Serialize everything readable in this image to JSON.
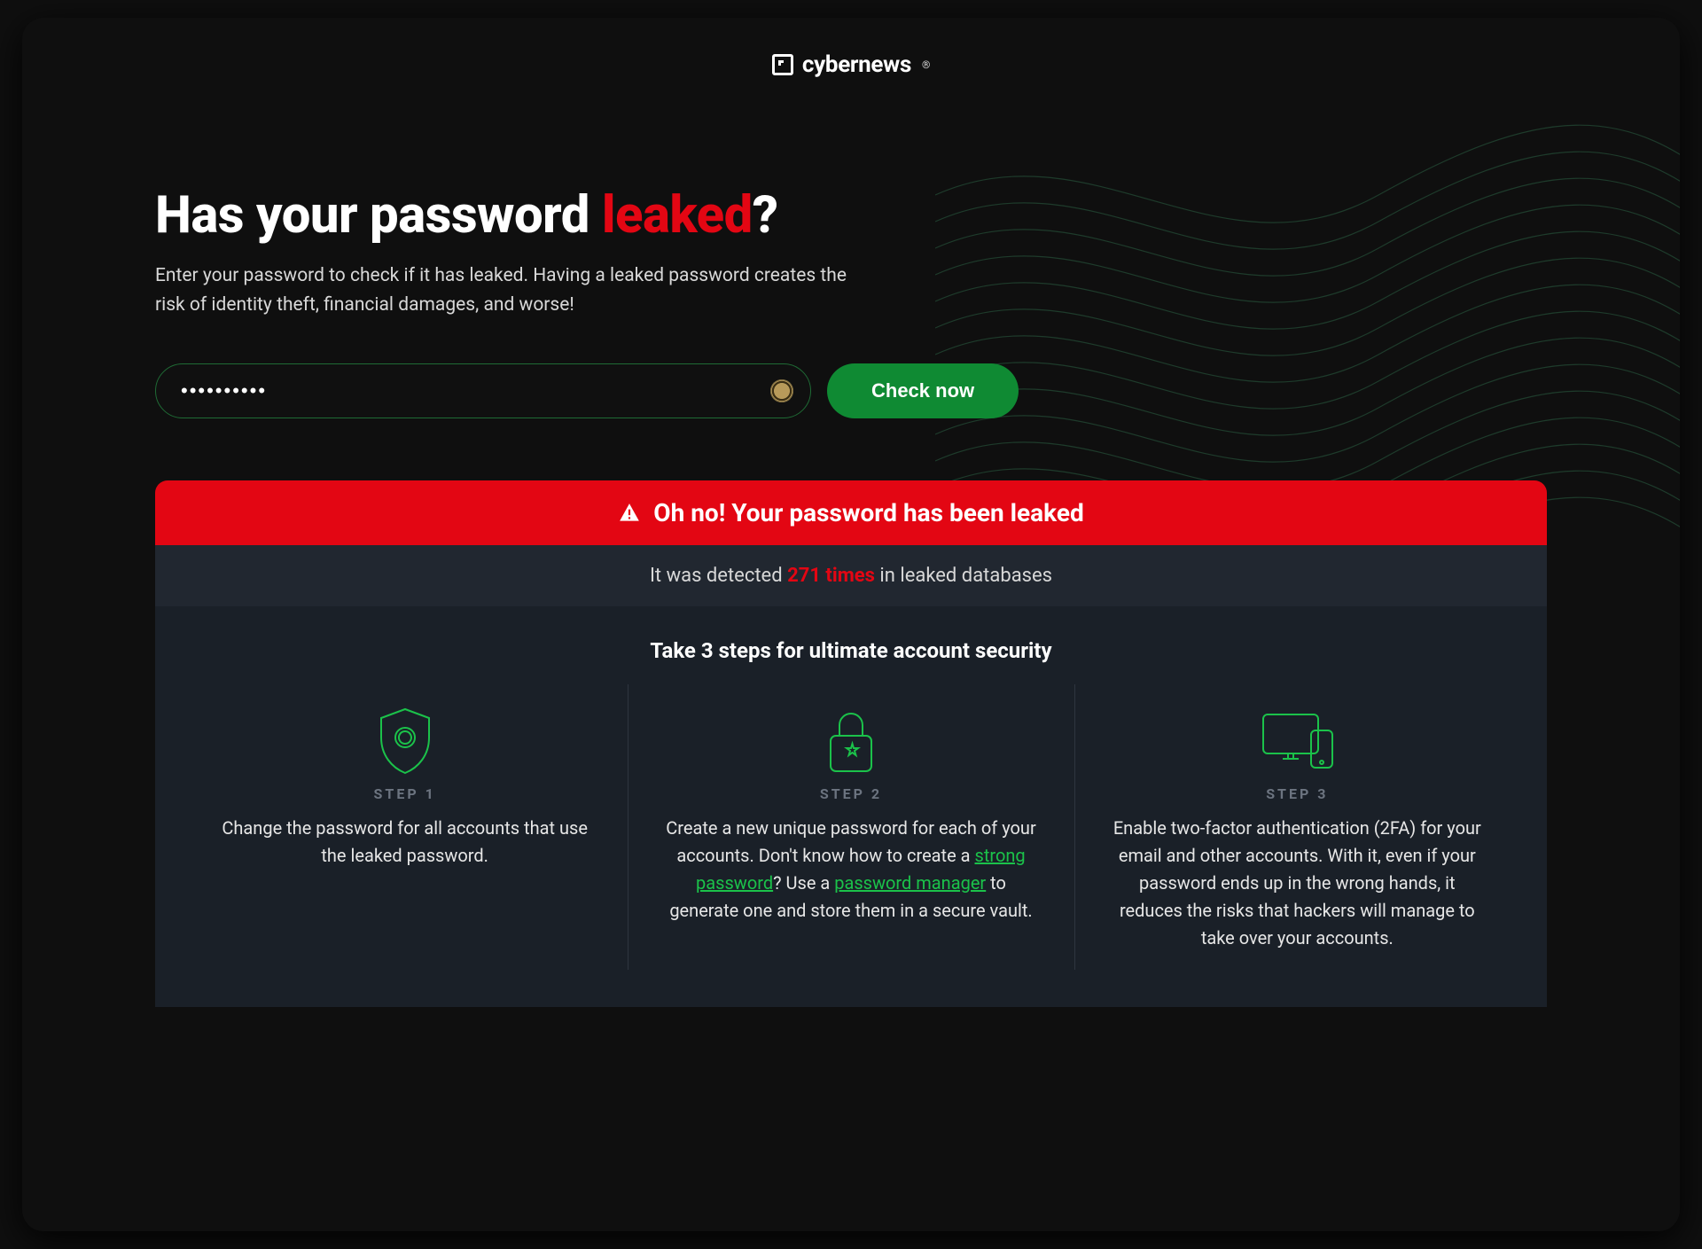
{
  "brand": {
    "name": "cybernews",
    "mark": "®"
  },
  "hero": {
    "title_pre": "Has your password ",
    "title_highlight": "leaked",
    "title_post": "?",
    "subtitle": "Enter your password to check if it has leaked. Having a leaked password creates the risk of identity theft, financial damages, and worse!"
  },
  "form": {
    "password_value": "••••••••••",
    "check_label": "Check now"
  },
  "alert": {
    "message": "Oh no! Your password has been leaked"
  },
  "detected": {
    "pre": "It was detected ",
    "count": "271 times",
    "post": " in leaked databases"
  },
  "advice": {
    "title": "Take 3 steps for ultimate account security",
    "steps": [
      {
        "label": "STEP 1",
        "text": "Change the password for all accounts that use the leaked password."
      },
      {
        "label": "STEP 2",
        "seg1": "Create a new unique password for each of your accounts. Don't know how to create a ",
        "link1": "strong password",
        "seg2": "? Use a ",
        "link2": "password manager",
        "seg3": " to generate one and store them in a secure vault."
      },
      {
        "label": "STEP 3",
        "text": "Enable two-factor authentication (2FA) for your email and other accounts. With it, even if your password ends up in the wrong hands, it reduces the risks that hackers will manage to take over your accounts."
      }
    ]
  }
}
